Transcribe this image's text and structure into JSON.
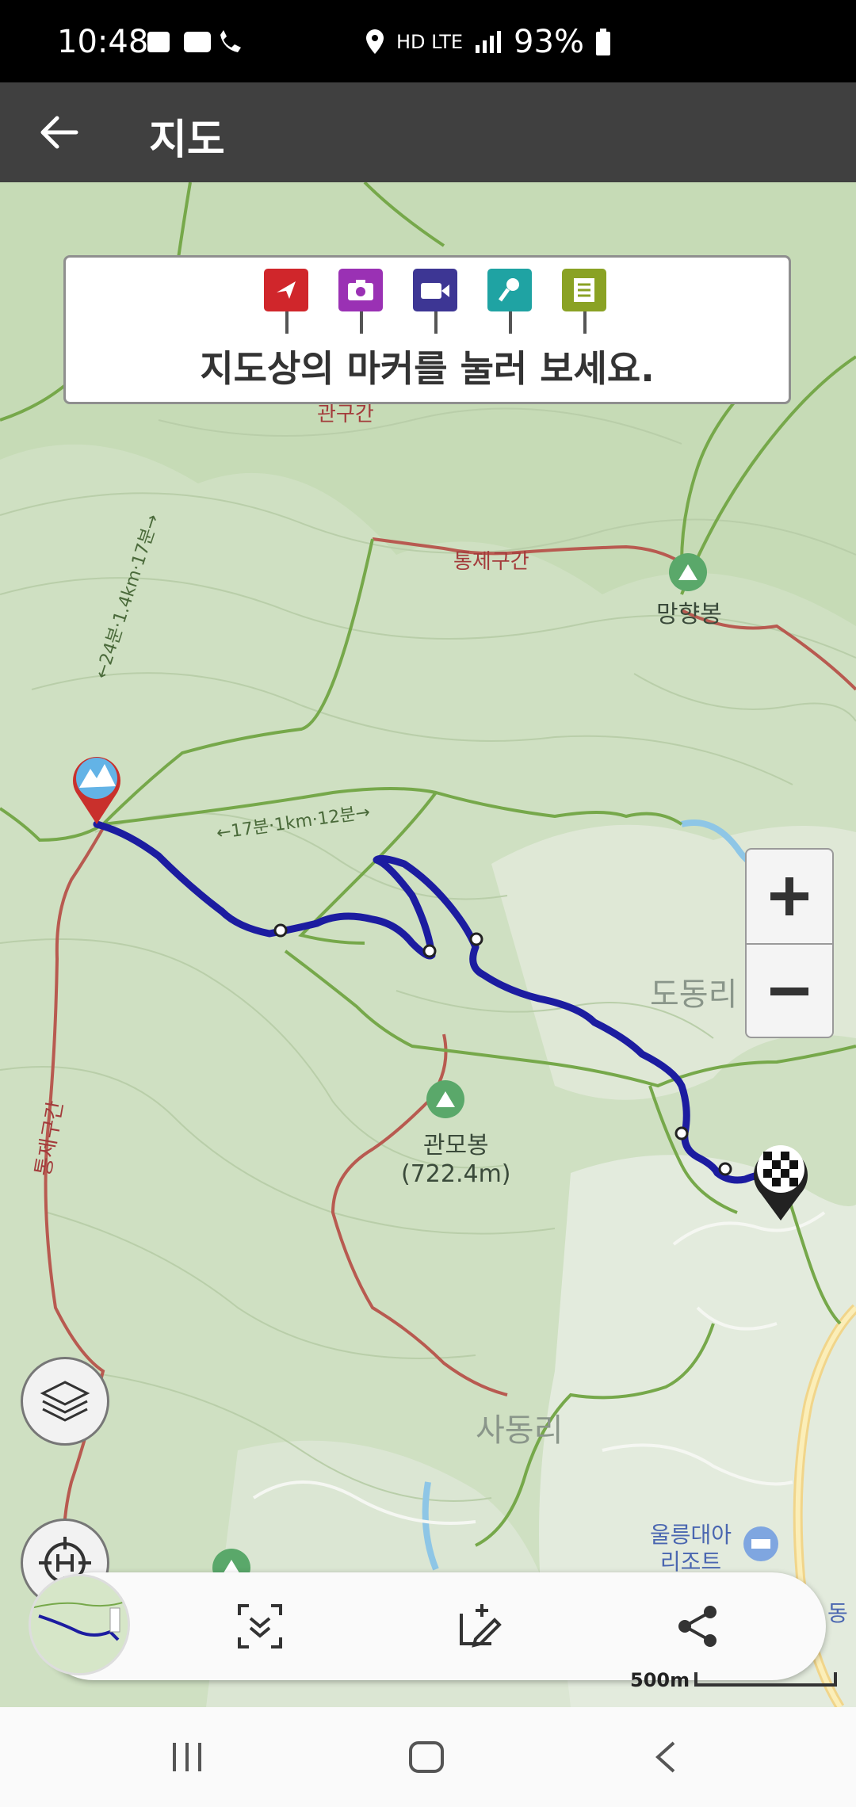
{
  "status_bar": {
    "time": "10:48",
    "network": "HD LTE",
    "battery": "93%"
  },
  "app_bar": {
    "title": "지도"
  },
  "info_box": {
    "hint": "지도상의 마커를 눌러 보세요.",
    "markers": [
      {
        "name": "flag-marker",
        "color": "#d0262b"
      },
      {
        "name": "camera-marker",
        "color": "#9a31b4"
      },
      {
        "name": "video-marker",
        "color": "#3d3694"
      },
      {
        "name": "mic-marker",
        "color": "#1fa3a3"
      },
      {
        "name": "memo-marker",
        "color": "#8aa224"
      }
    ]
  },
  "map": {
    "labels": {
      "top_partial": "관구간",
      "restricted_1": "통제구간",
      "peak_1": "망향봉",
      "trail_1": "←24분·1.4km·17분→",
      "trail_2": "←17분·1km·12분→",
      "village_1": "도동리",
      "peak_2_name": "관모봉",
      "peak_2_height": "(722.4m)",
      "restricted_2": "통제구간",
      "village_2": "사동리",
      "resort_1": "울릉대아",
      "resort_2": "리조트",
      "edge_partial": "동"
    },
    "route_color": "#1c1ca0",
    "restricted_color": "#b85a50",
    "trail_color": "#76a84a"
  },
  "scale": {
    "label": "500m"
  }
}
